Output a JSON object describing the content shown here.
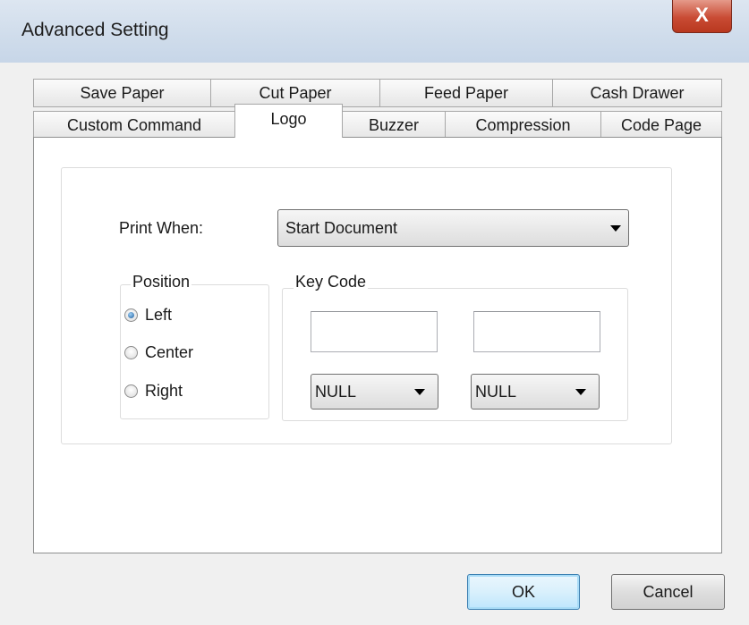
{
  "window": {
    "title": "Advanced Setting",
    "close_label": "X"
  },
  "tabs_row1": [
    "Save Paper",
    "Cut Paper",
    "Feed Paper",
    "Cash Drawer"
  ],
  "tabs_row2": [
    "Custom Command",
    "Logo",
    "Buzzer",
    "Compression",
    "Code Page"
  ],
  "active_tab": "Logo",
  "print_when": {
    "label": "Print When:",
    "value": "Start Document"
  },
  "position": {
    "label": "Position",
    "options": [
      "Left",
      "Center",
      "Right"
    ],
    "selected": "Left"
  },
  "key_code": {
    "label": "Key Code",
    "field1": "",
    "field2": "",
    "select1": "NULL",
    "select2": "NULL"
  },
  "buttons": {
    "ok": "OK",
    "cancel": "Cancel"
  }
}
